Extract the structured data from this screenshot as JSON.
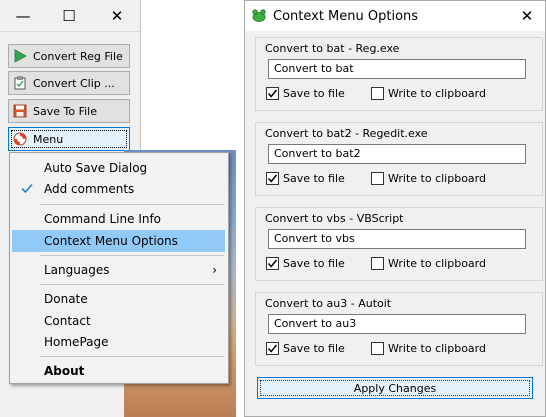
{
  "main_window": {
    "buttons": [
      {
        "label": "Convert Reg File",
        "icon": "play-icon"
      },
      {
        "label": "Convert Clip ...",
        "icon": "clipboard-icon"
      },
      {
        "label": "Save To File",
        "icon": "floppy-disk-icon"
      },
      {
        "label": "Menu",
        "icon": "lifebuoy-icon"
      }
    ],
    "window_controls": {
      "minimize": "—",
      "maximize": "☐",
      "close": "✕"
    }
  },
  "popup_menu": {
    "items": [
      {
        "label": "Auto Save Dialog",
        "checked": false
      },
      {
        "label": "Add comments",
        "checked": true
      },
      {
        "label": "Command Line Info",
        "checked": false
      },
      {
        "label": "Context Menu Options",
        "highlighted": true
      },
      {
        "label": "Languages",
        "submenu": true,
        "arrow": "›"
      },
      {
        "label": "Donate"
      },
      {
        "label": "Contact"
      },
      {
        "label": "HomePage"
      },
      {
        "label": "About",
        "bold": true
      }
    ]
  },
  "dialog": {
    "title": "Context Menu Options",
    "close": "✕",
    "groups": [
      {
        "title": "Convert to bat - Reg.exe",
        "value": "Convert to bat",
        "save_to_file": "Save to file",
        "save_checked": true,
        "write_clipboard": "Write to clipboard",
        "clip_checked": false
      },
      {
        "title": "Convert to bat2 - Regedit.exe",
        "value": "Convert to bat2",
        "save_to_file": "Save to file",
        "save_checked": true,
        "write_clipboard": "Write to clipboard",
        "clip_checked": false
      },
      {
        "title": "Convert to vbs - VBScript",
        "value": "Convert to vbs",
        "save_to_file": "Save to file",
        "save_checked": true,
        "write_clipboard": "Write to clipboard",
        "clip_checked": false
      },
      {
        "title": "Convert to au3 - Autoit",
        "value": "Convert to au3",
        "save_to_file": "Save to file",
        "save_checked": true,
        "write_clipboard": "Write to clipboard",
        "clip_checked": false
      }
    ],
    "apply_label": "Apply Changes"
  },
  "colors": {
    "accent": "#0078d7",
    "menu_highlight": "#91c9f7",
    "check": "#2a7fd4",
    "play_green": "#2fa84f"
  }
}
